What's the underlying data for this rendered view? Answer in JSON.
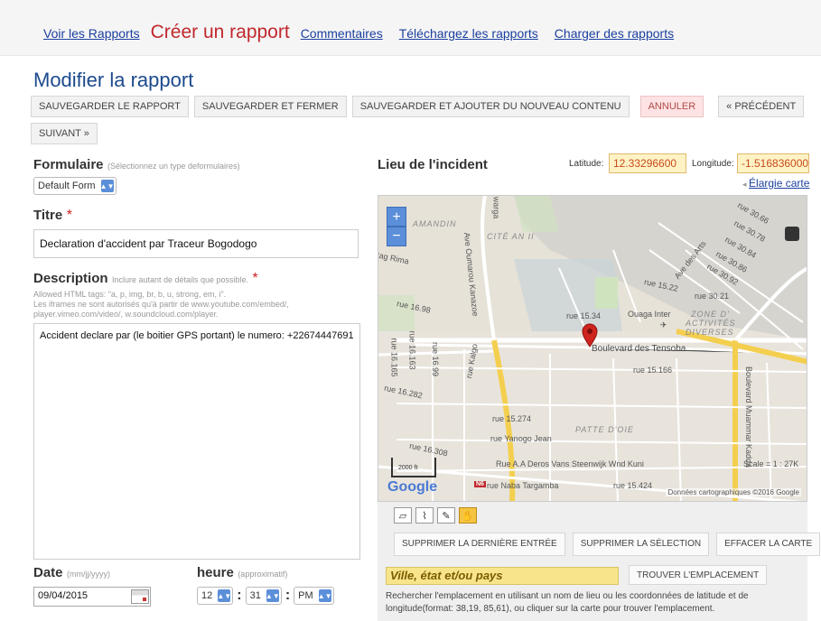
{
  "nav": {
    "voir": "Voir les Rapports",
    "creer": "Créer un rapport",
    "commentaires": "Commentaires",
    "telecharger": "Téléchargez les rapports",
    "charger": "Charger des rapports"
  },
  "page_title": "Modifier la rapport",
  "actions": {
    "save": "SAUVEGARDER LE RAPPORT",
    "save_close": "SAUVEGARDER ET FERMER",
    "save_new": "SAUVEGARDER ET AJOUTER DU NOUVEAU CONTENU",
    "cancel": "ANNULER",
    "prev": "« PRÉCÉDENT",
    "next": "SUIVANT »"
  },
  "form": {
    "formulaire_label": "Formulaire",
    "formulaire_hint": "(Sélectionnez un type deformulaires)",
    "formulaire_value": "Default Form",
    "titre_label": "Titre",
    "titre_value": "Declaration d'accident par Traceur Bogodogo",
    "description_label": "Description",
    "description_hint": "Inclure autant de détails que possible.",
    "allowed_tags": "Allowed HTML tags: \"a, p, img, br, b, u, strong, em, i\".",
    "iframes_note": "Les iframes ne sont autorisés qu'à partir de www.youtube.com/embed/, player.vimeo.com/video/, w.soundcloud.com/player.",
    "description_value": "Accident declare par (le boitier GPS portant) le numero: +22674447691",
    "date_label": "Date",
    "date_hint": "(mm/jj/yyyy)",
    "date_value": "09/04/2015",
    "heure_label": "heure",
    "heure_hint": "(approximatif)",
    "hour": "12",
    "minute": "31",
    "ampm": "PM"
  },
  "location": {
    "title": "Lieu de l'incident",
    "latitude_label": "Latitude:",
    "latitude_value": "12.33296600",
    "longitude_label": "Longitude:",
    "longitude_value": "-1.516836000",
    "enlarge": "Élargie carte"
  },
  "map": {
    "labels": {
      "amandin": "AMANDIN",
      "cite_an": "CITÉ AN II",
      "warga": "warga",
      "rima": "tag Rima",
      "oumarou": "Ave Oumarou Kanazoe",
      "r1698": "rue 16.98",
      "r1522": "rue 15.22",
      "r3021": "rue 30.21",
      "r3066": "rue 30.66",
      "r3078": "rue 30.78",
      "r3084": "rue 30.84",
      "r3086": "rue 30.86",
      "r3092": "rue 30.92",
      "arts": "Ave des Arts",
      "r1534": "rue 15.34",
      "ouaga": "Ouaga Inter",
      "zone1": "ZONE D'",
      "zone2": "ACTIVITÉS",
      "zone3": "DIVERSES",
      "tensoba": "Boulevard des Tensoba",
      "r16165": "rue 16.165",
      "r16163": "rue 16.163",
      "r1699": "rue 16.99",
      "kalgo": "rue Kalgo",
      "r16282": "rue 16.282",
      "r15166": "rue 15.166",
      "muammar": "Boulevard Muammar Kadda",
      "r15274": "rue 15.274",
      "patte": "PATTE D'OIE",
      "yanogo": "rue Yanogo Jean",
      "r16308": "rue 16.308",
      "deros": "Rue A.A Deros Vans Steenwijk Wnd Kuni",
      "naba": "rue Naba Targamba",
      "r15424": "rue 15.424",
      "n6": "N6",
      "scale": "Scale = 1 : 27K",
      "scale_bar": "2000 ft",
      "copyright": "Données cartographiques ©2016 Google",
      "google": "Google"
    }
  },
  "panel": {
    "delete_last": "SUPPRIMER LA DERNIÈRE ENTRÉE",
    "delete_sel": "SUPPRIMER LA SÉLECTION",
    "clear_map": "EFFACER LA CARTE",
    "find": "TROUVER L'EMPLACEMENT",
    "location_placeholder": "Ville, état et/ou pays",
    "help": "Rechercher l'emplacement en utilisant un nom de lieu ou les coordonnées de latitude et de longitude(format: 38,19, 85,61), ou cliquer sur la carte pour trouver l'emplacement."
  }
}
